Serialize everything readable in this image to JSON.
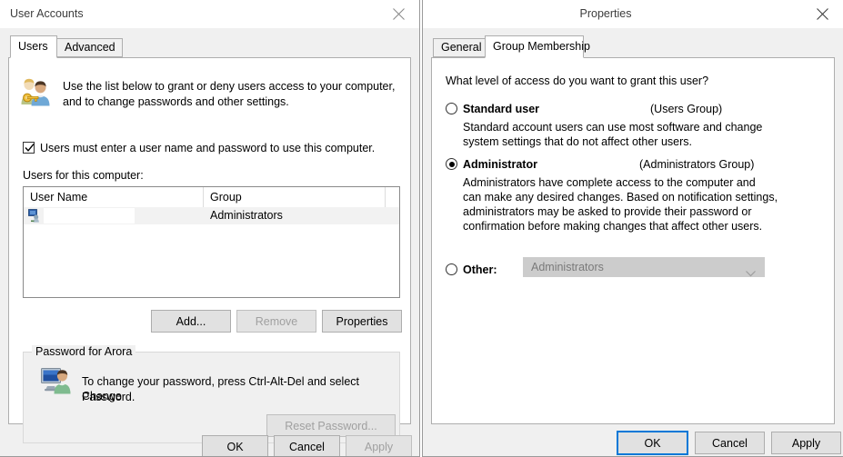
{
  "user_accounts": {
    "title": "User Accounts",
    "close_icon": "close-icon",
    "tabs": [
      {
        "label": "Users",
        "active": true
      },
      {
        "label": "Advanced",
        "active": false
      }
    ],
    "header_icon": "users-key-icon",
    "intro_line1": "Use the list below to grant or deny users access to your computer,",
    "intro_line2": "and to change passwords and other settings.",
    "require_password_checkbox": {
      "label": "Users must enter a user name and password to use this computer.",
      "checked": true
    },
    "list_label": "Users for this computer:",
    "list": {
      "columns": [
        "User Name",
        "Group"
      ],
      "rows": [
        {
          "icon": "user-icon",
          "user_name": "",
          "group": "Administrators",
          "selected": true
        }
      ]
    },
    "buttons": {
      "add": "Add...",
      "remove": "Remove",
      "properties": "Properties"
    },
    "password_group": {
      "title": "Password for Arora",
      "icon": "user-monitor-icon",
      "text_line1": "To change your password, press Ctrl-Alt-Del and select Change",
      "text_line2": "Password.",
      "reset_button": "Reset Password..."
    },
    "footer": {
      "ok": "OK",
      "cancel": "Cancel",
      "apply": "Apply"
    }
  },
  "properties": {
    "title": "Properties",
    "close_icon": "close-icon",
    "tabs": [
      {
        "label": "General",
        "active": false
      },
      {
        "label": "Group Membership",
        "active": true
      }
    ],
    "question": "What level of access do you want to grant this user?",
    "options": [
      {
        "label": "Standard user",
        "group": "(Users Group)",
        "selected": false,
        "description": [
          "Standard account users can use most software and change",
          "system settings that do not affect other users."
        ]
      },
      {
        "label": "Administrator",
        "group": "(Administrators Group)",
        "selected": true,
        "description": [
          "Administrators have complete access to the computer and",
          "can make any desired changes. Based on notification settings,",
          "administrators may be asked to provide their password or",
          "confirmation before making changes that affect other users."
        ]
      },
      {
        "label": "Other:",
        "selected": false,
        "combo_value": "Administrators",
        "combo_disabled": true
      }
    ],
    "footer": {
      "ok": "OK",
      "cancel": "Cancel",
      "apply": "Apply"
    }
  },
  "colors": {
    "focus_blue": "#0078d7",
    "dialog_bg": "#f0f0f0",
    "button_bg": "#e1e1e1",
    "selected_row": "#f2f2f2"
  }
}
